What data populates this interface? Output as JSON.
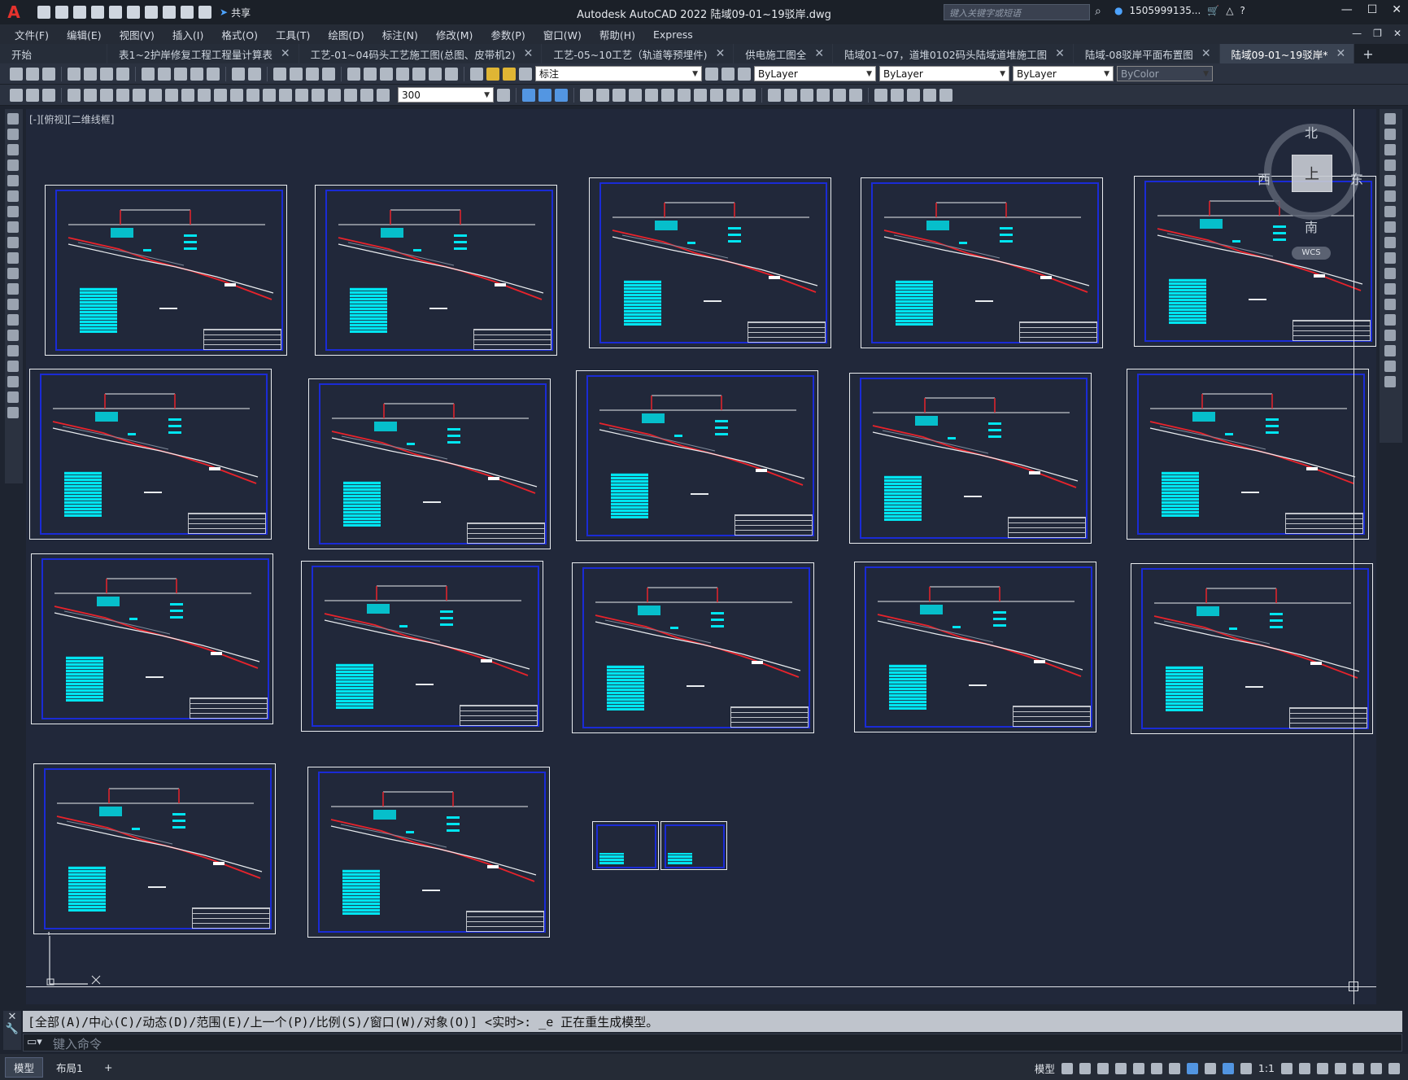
{
  "app": {
    "title": "Autodesk AutoCAD 2022    陆域09-01~19驳岸.dwg",
    "share": "共享",
    "search_placeholder": "键入关键字或短语",
    "user": "1505999135...",
    "logo": "A"
  },
  "menu": [
    "文件(F)",
    "编辑(E)",
    "视图(V)",
    "插入(I)",
    "格式(O)",
    "工具(T)",
    "绘图(D)",
    "标注(N)",
    "修改(M)",
    "参数(P)",
    "窗口(W)",
    "帮助(H)",
    "Express"
  ],
  "tabs": [
    {
      "label": "开始",
      "close": false
    },
    {
      "label": "表1~2护岸修复工程工程量计算表",
      "close": true
    },
    {
      "label": "工艺-01~04码头工艺施工图(总图、皮带机2)",
      "close": true
    },
    {
      "label": "工艺-05~10工艺（轨道等预埋件)",
      "close": true
    },
    {
      "label": "供电施工图全",
      "close": true
    },
    {
      "label": "陆域01~07，道堆0102码头陆域道堆施工图",
      "close": true
    },
    {
      "label": "陆域-08驳岸平面布置图",
      "close": true
    },
    {
      "label": "陆域09-01~19驳岸*",
      "close": true,
      "active": true
    }
  ],
  "toolbar": {
    "layer_value": "标注",
    "color_value": "ByLayer",
    "linetype_value": "ByLayer",
    "lineweight_value": "ByLayer",
    "plotstyle_value": "ByColor",
    "dimscale_value": "300"
  },
  "viewport": {
    "label": "[-][俯视][二维线框]",
    "viewcube_top": "上",
    "north": "北",
    "south": "南",
    "east": "东",
    "west": "西",
    "wcs": "WCS"
  },
  "command": {
    "history": "[全部(A)/中心(C)/动态(D)/范围(E)/上一个(P)/比例(S)/窗口(W)/对象(O)] <实时>: _e 正在重生成模型。",
    "placeholder": "键入命令"
  },
  "status": {
    "model_tab": "模型",
    "layout_tab": "布局1",
    "add_tab": "+",
    "model_label": "模型",
    "scale": "1:1"
  },
  "colors": {
    "frame_blue": "#1a2bd6",
    "cyan": "#00e5f0",
    "red": "#e8232b",
    "accent": "#4da3ff"
  }
}
